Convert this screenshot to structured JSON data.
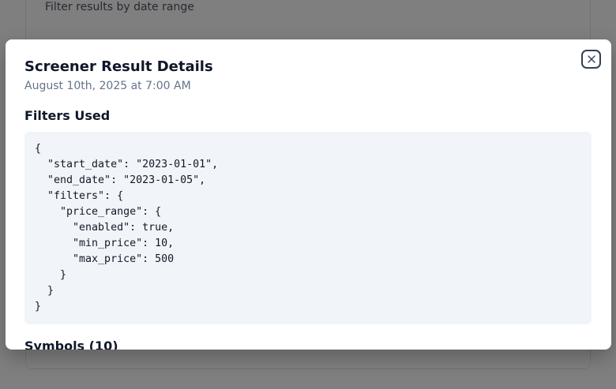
{
  "background": {
    "filter_label": "Filter results by date range"
  },
  "modal": {
    "title": "Screener Result Details",
    "subtitle": "August 10th, 2025 at 7:00 AM",
    "close_icon": "x-circle-icon",
    "filters_heading": "Filters Used",
    "filters_json": "{\n  \"start_date\": \"2023-01-01\",\n  \"end_date\": \"2023-01-05\",\n  \"filters\": {\n    \"price_range\": {\n      \"enabled\": true,\n      \"min_price\": 10,\n      \"max_price\": 500\n    }\n  }\n}",
    "symbols_heading": "Symbols (10)"
  },
  "colors": {
    "overlay": "#7f7f7f",
    "code_background": "#f1f5f9",
    "title_text": "#0f172a",
    "subtitle_text": "#64748b"
  }
}
